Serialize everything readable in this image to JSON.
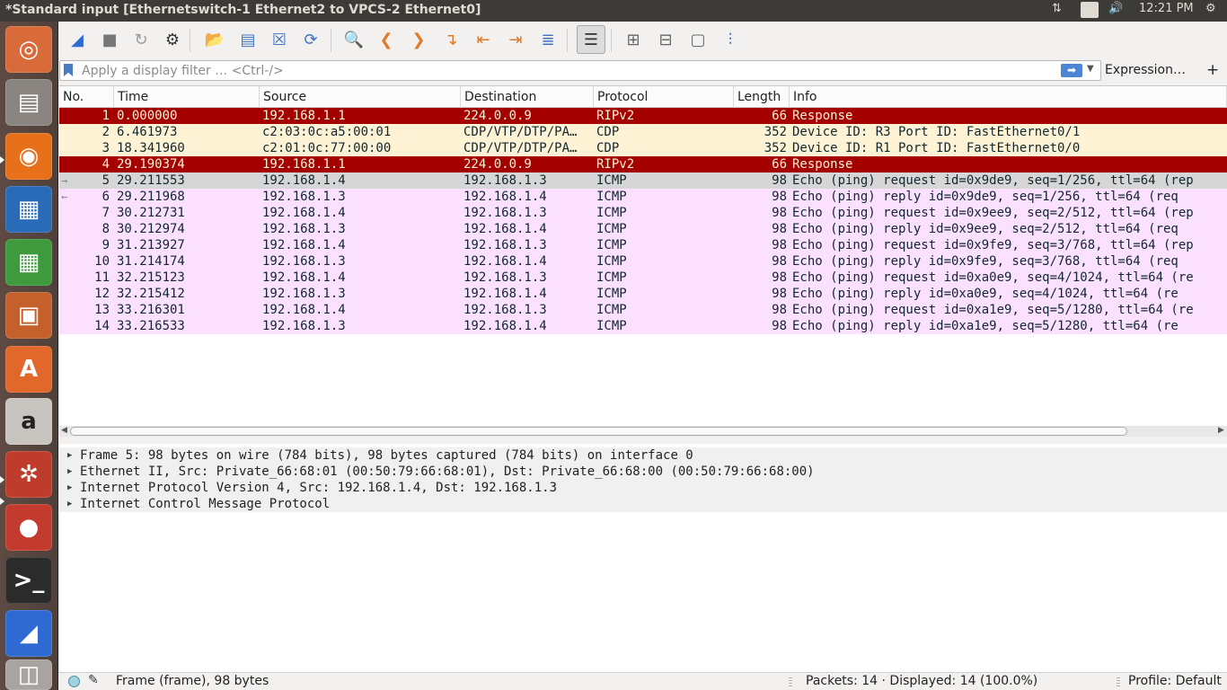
{
  "topbar": {
    "window_title": "*Standard input [Ethernetswitch-1 Ethernet2 to VPCS-2 Ethernet0]",
    "keyboard_lang": "En",
    "clock": "12:21 PM"
  },
  "launcher": {
    "items": [
      {
        "name": "ubuntu-dash",
        "icon": "ubuntu-logo-icon",
        "color": "#d96a3a"
      },
      {
        "name": "files",
        "icon": "file-cabinet-icon",
        "color": "#8a8580"
      },
      {
        "name": "firefox",
        "icon": "firefox-icon",
        "color": "#e8701a"
      },
      {
        "name": "libreoffice-writer",
        "icon": "writer-document-icon",
        "color": "#2a6bb8"
      },
      {
        "name": "libreoffice-calc",
        "icon": "calc-spreadsheet-icon",
        "color": "#3e9a3c"
      },
      {
        "name": "libreoffice-impress",
        "icon": "impress-presentation-icon",
        "color": "#c4602c"
      },
      {
        "name": "ubuntu-software",
        "icon": "software-center-bag-icon",
        "color": "#e2672a"
      },
      {
        "name": "amazon",
        "icon": "amazon-logo-icon",
        "color": "#c8c4bf"
      },
      {
        "name": "system-settings",
        "icon": "settings-wrench-icon",
        "color": "#bf3c2c"
      },
      {
        "name": "gns3",
        "icon": "gns3-icon",
        "color": "#c23b2e"
      },
      {
        "name": "terminal",
        "icon": "terminal-icon",
        "color": "#2b2b2b"
      },
      {
        "name": "wireshark",
        "icon": "wireshark-fin-icon",
        "color": "#2e6ad1"
      },
      {
        "name": "disk",
        "icon": "disk-drive-icon",
        "color": "#a9a49f"
      }
    ]
  },
  "toolbar": {
    "buttons": [
      {
        "name": "start-capture-button",
        "icon": "shark-fin-icon"
      },
      {
        "name": "stop-capture-button",
        "icon": "stop-square-icon"
      },
      {
        "name": "restart-capture-button",
        "icon": "restart-fin-icon"
      },
      {
        "name": "capture-options-button",
        "icon": "gear-icon"
      },
      {
        "name": "open-file-button",
        "icon": "folder-open-icon"
      },
      {
        "name": "save-file-button",
        "icon": "save-file-icon"
      },
      {
        "name": "close-file-button",
        "icon": "close-file-icon"
      },
      {
        "name": "reload-file-button",
        "icon": "reload-icon"
      },
      {
        "name": "find-packet-button",
        "icon": "magnifier-icon"
      },
      {
        "name": "go-back-button",
        "icon": "chevron-left-icon"
      },
      {
        "name": "go-forward-button",
        "icon": "chevron-right-icon"
      },
      {
        "name": "go-to-packet-button",
        "icon": "jump-arrow-icon"
      },
      {
        "name": "first-packet-button",
        "icon": "first-packet-icon"
      },
      {
        "name": "last-packet-button",
        "icon": "last-packet-icon"
      },
      {
        "name": "autoscroll-button",
        "icon": "autoscroll-icon"
      },
      {
        "name": "colorize-button",
        "icon": "colorize-lines-icon"
      },
      {
        "name": "zoom-in-button",
        "icon": "zoom-in-icon"
      },
      {
        "name": "zoom-out-button",
        "icon": "zoom-out-icon"
      },
      {
        "name": "normal-size-button",
        "icon": "zoom-normal-icon"
      },
      {
        "name": "resize-columns-button",
        "icon": "resize-columns-icon"
      }
    ]
  },
  "filter": {
    "placeholder": "Apply a display filter … <Ctrl-/>",
    "expression_label": "Expression…",
    "add_label": "+"
  },
  "packet_list": {
    "columns": [
      "No.",
      "Time",
      "Source",
      "Destination",
      "Protocol",
      "Length",
      "Info"
    ],
    "rows": [
      {
        "no": "1",
        "time": "0.000000",
        "src": "192.168.1.1",
        "dst": "224.0.0.9",
        "proto": "RIPv2",
        "len": "66",
        "info": "Response",
        "style": "rip"
      },
      {
        "no": "2",
        "time": "6.461973",
        "src": "c2:03:0c:a5:00:01",
        "dst": "CDP/VTP/DTP/PA…",
        "proto": "CDP",
        "len": "352",
        "info": "Device ID: R3  Port ID: FastEthernet0/1",
        "style": "cdp"
      },
      {
        "no": "3",
        "time": "18.341960",
        "src": "c2:01:0c:77:00:00",
        "dst": "CDP/VTP/DTP/PA…",
        "proto": "CDP",
        "len": "352",
        "info": "Device ID: R1  Port ID: FastEthernet0/0",
        "style": "cdp"
      },
      {
        "no": "4",
        "time": "29.190374",
        "src": "192.168.1.1",
        "dst": "224.0.0.9",
        "proto": "RIPv2",
        "len": "66",
        "info": "Response",
        "style": "rip"
      },
      {
        "no": "5",
        "time": "29.211553",
        "src": "192.168.1.4",
        "dst": "192.168.1.3",
        "proto": "ICMP",
        "len": "98",
        "info": "Echo (ping) request  id=0x9de9, seq=1/256, ttl=64 (rep",
        "style": "selected",
        "mark": "→"
      },
      {
        "no": "6",
        "time": "29.211968",
        "src": "192.168.1.3",
        "dst": "192.168.1.4",
        "proto": "ICMP",
        "len": "98",
        "info": "Echo (ping) reply    id=0x9de9, seq=1/256, ttl=64 (req",
        "style": "icmp",
        "mark": "←"
      },
      {
        "no": "7",
        "time": "30.212731",
        "src": "192.168.1.4",
        "dst": "192.168.1.3",
        "proto": "ICMP",
        "len": "98",
        "info": "Echo (ping) request  id=0x9ee9, seq=2/512, ttl=64 (rep",
        "style": "icmp"
      },
      {
        "no": "8",
        "time": "30.212974",
        "src": "192.168.1.3",
        "dst": "192.168.1.4",
        "proto": "ICMP",
        "len": "98",
        "info": "Echo (ping) reply    id=0x9ee9, seq=2/512, ttl=64 (req",
        "style": "icmp"
      },
      {
        "no": "9",
        "time": "31.213927",
        "src": "192.168.1.4",
        "dst": "192.168.1.3",
        "proto": "ICMP",
        "len": "98",
        "info": "Echo (ping) request  id=0x9fe9, seq=3/768, ttl=64 (rep",
        "style": "icmp"
      },
      {
        "no": "10",
        "time": "31.214174",
        "src": "192.168.1.3",
        "dst": "192.168.1.4",
        "proto": "ICMP",
        "len": "98",
        "info": "Echo (ping) reply    id=0x9fe9, seq=3/768, ttl=64 (req",
        "style": "icmp"
      },
      {
        "no": "11",
        "time": "32.215123",
        "src": "192.168.1.4",
        "dst": "192.168.1.3",
        "proto": "ICMP",
        "len": "98",
        "info": "Echo (ping) request  id=0xa0e9, seq=4/1024, ttl=64 (re",
        "style": "icmp"
      },
      {
        "no": "12",
        "time": "32.215412",
        "src": "192.168.1.3",
        "dst": "192.168.1.4",
        "proto": "ICMP",
        "len": "98",
        "info": "Echo (ping) reply    id=0xa0e9, seq=4/1024, ttl=64 (re",
        "style": "icmp"
      },
      {
        "no": "13",
        "time": "33.216301",
        "src": "192.168.1.4",
        "dst": "192.168.1.3",
        "proto": "ICMP",
        "len": "98",
        "info": "Echo (ping) request  id=0xa1e9, seq=5/1280, ttl=64 (re",
        "style": "icmp"
      },
      {
        "no": "14",
        "time": "33.216533",
        "src": "192.168.1.3",
        "dst": "192.168.1.4",
        "proto": "ICMP",
        "len": "98",
        "info": "Echo (ping) reply    id=0xa1e9, seq=5/1280, ttl=64 (re",
        "style": "icmp"
      }
    ],
    "row_colors": {
      "rip": {
        "bg": "#a40000",
        "fg": "#fff4d6"
      },
      "cdp": {
        "bg": "#fff3d6",
        "fg": "#12272e"
      },
      "icmp": {
        "bg": "#fce0ff",
        "fg": "#12272e"
      },
      "selected": {
        "bg": "#d6d6d6",
        "fg": "#12272e"
      }
    }
  },
  "details": {
    "items": [
      "Frame 5: 98 bytes on wire (784 bits), 98 bytes captured (784 bits) on interface 0",
      "Ethernet II, Src: Private_66:68:01 (00:50:79:66:68:01), Dst: Private_66:68:00 (00:50:79:66:68:00)",
      "Internet Protocol Version 4, Src: 192.168.1.4, Dst: 192.168.1.3",
      "Internet Control Message Protocol"
    ]
  },
  "statusbar": {
    "frame_text": "Frame (frame), 98 bytes",
    "packets_text": "Packets: 14 · Displayed: 14 (100.0%)",
    "profile_text": "Profile: Default"
  }
}
